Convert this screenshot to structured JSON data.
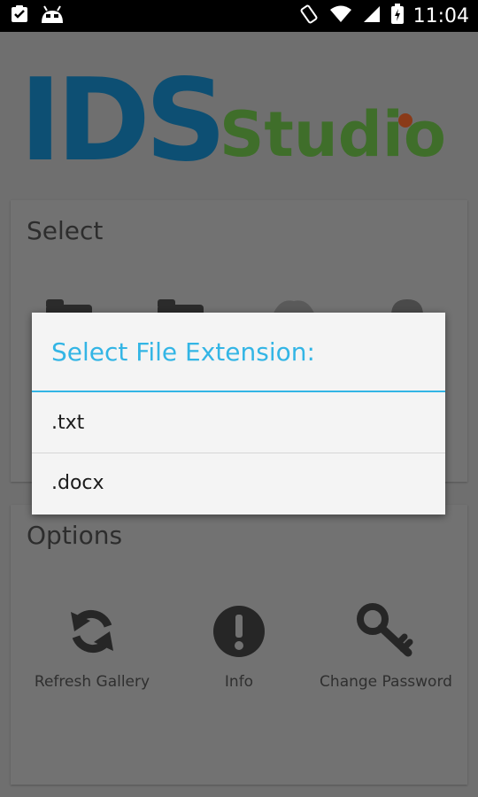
{
  "status_bar": {
    "time": "11:04",
    "icons": [
      "task-check-icon",
      "android-robot-icon",
      "rotate-icon",
      "wifi-icon",
      "signal-icon",
      "battery-charging-icon"
    ]
  },
  "logo": {
    "ids": "IDS",
    "studio": "Studio",
    "ids_color": "#0d4f73",
    "studio_color": "#3f6e2a"
  },
  "select_card": {
    "title": "Select"
  },
  "dialog": {
    "title": "Select File Extension:",
    "accent": "#33b5e5",
    "items": [
      ".txt",
      ".docx"
    ]
  },
  "options_card": {
    "title": "Options",
    "items": [
      {
        "label": "Refresh Gallery",
        "icon": "refresh-icon"
      },
      {
        "label": "Info",
        "icon": "info-icon"
      },
      {
        "label": "Change Password",
        "icon": "key-icon"
      }
    ]
  }
}
